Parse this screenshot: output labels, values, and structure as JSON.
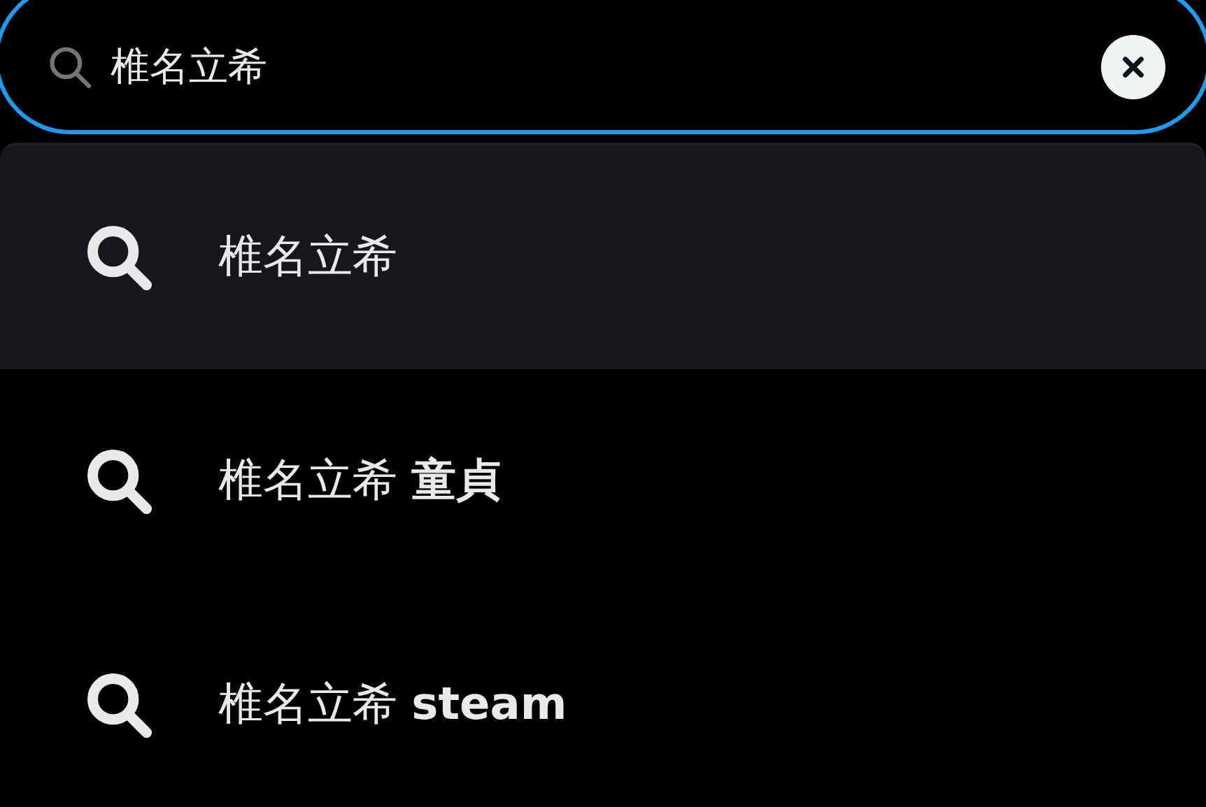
{
  "search": {
    "value": "椎名立希",
    "focused": true
  },
  "suggestions": [
    {
      "text": "椎名立希",
      "selected": true
    },
    {
      "text": "椎名立希 **童貞**",
      "selected": false
    },
    {
      "text": "椎名立希 **steam**",
      "selected": false
    }
  ]
}
